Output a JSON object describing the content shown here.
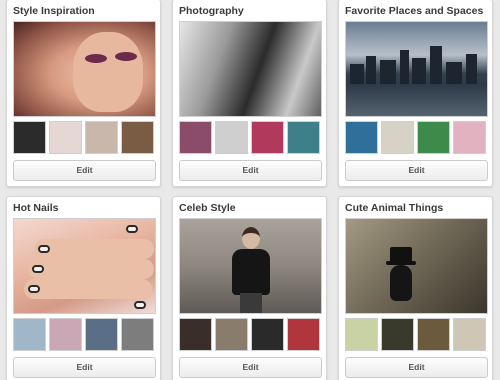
{
  "boards": [
    {
      "title": "Style Inspiration",
      "edit_label": "Edit",
      "thumbs": [
        "#2b2b2b",
        "#e4d7d4",
        "#c9b7ac",
        "#7a5b43"
      ]
    },
    {
      "title": "Photography",
      "edit_label": "Edit",
      "thumbs": [
        "#8b4c6a",
        "#cfcfcf",
        "#b13a5c",
        "#3f7f8a"
      ]
    },
    {
      "title": "Favorite Places and Spaces",
      "edit_label": "Edit",
      "thumbs": [
        "#2f6f9a",
        "#d8d2c6",
        "#3d8a4a",
        "#e1b3c0"
      ]
    },
    {
      "title": "Hot Nails",
      "edit_label": "Edit",
      "thumbs": [
        "#9fb7c9",
        "#c9a7b5",
        "#5a6f86",
        "#7d7d7d"
      ]
    },
    {
      "title": "Celeb Style",
      "edit_label": "Edit",
      "thumbs": [
        "#3a2e2a",
        "#8a7c6c",
        "#2a2a2a",
        "#b1353c"
      ]
    },
    {
      "title": "Cute Animal Things",
      "edit_label": "Edit",
      "thumbs": [
        "#c8d2a4",
        "#3a3a2c",
        "#6a5a3e",
        "#cfc7b5"
      ]
    }
  ]
}
